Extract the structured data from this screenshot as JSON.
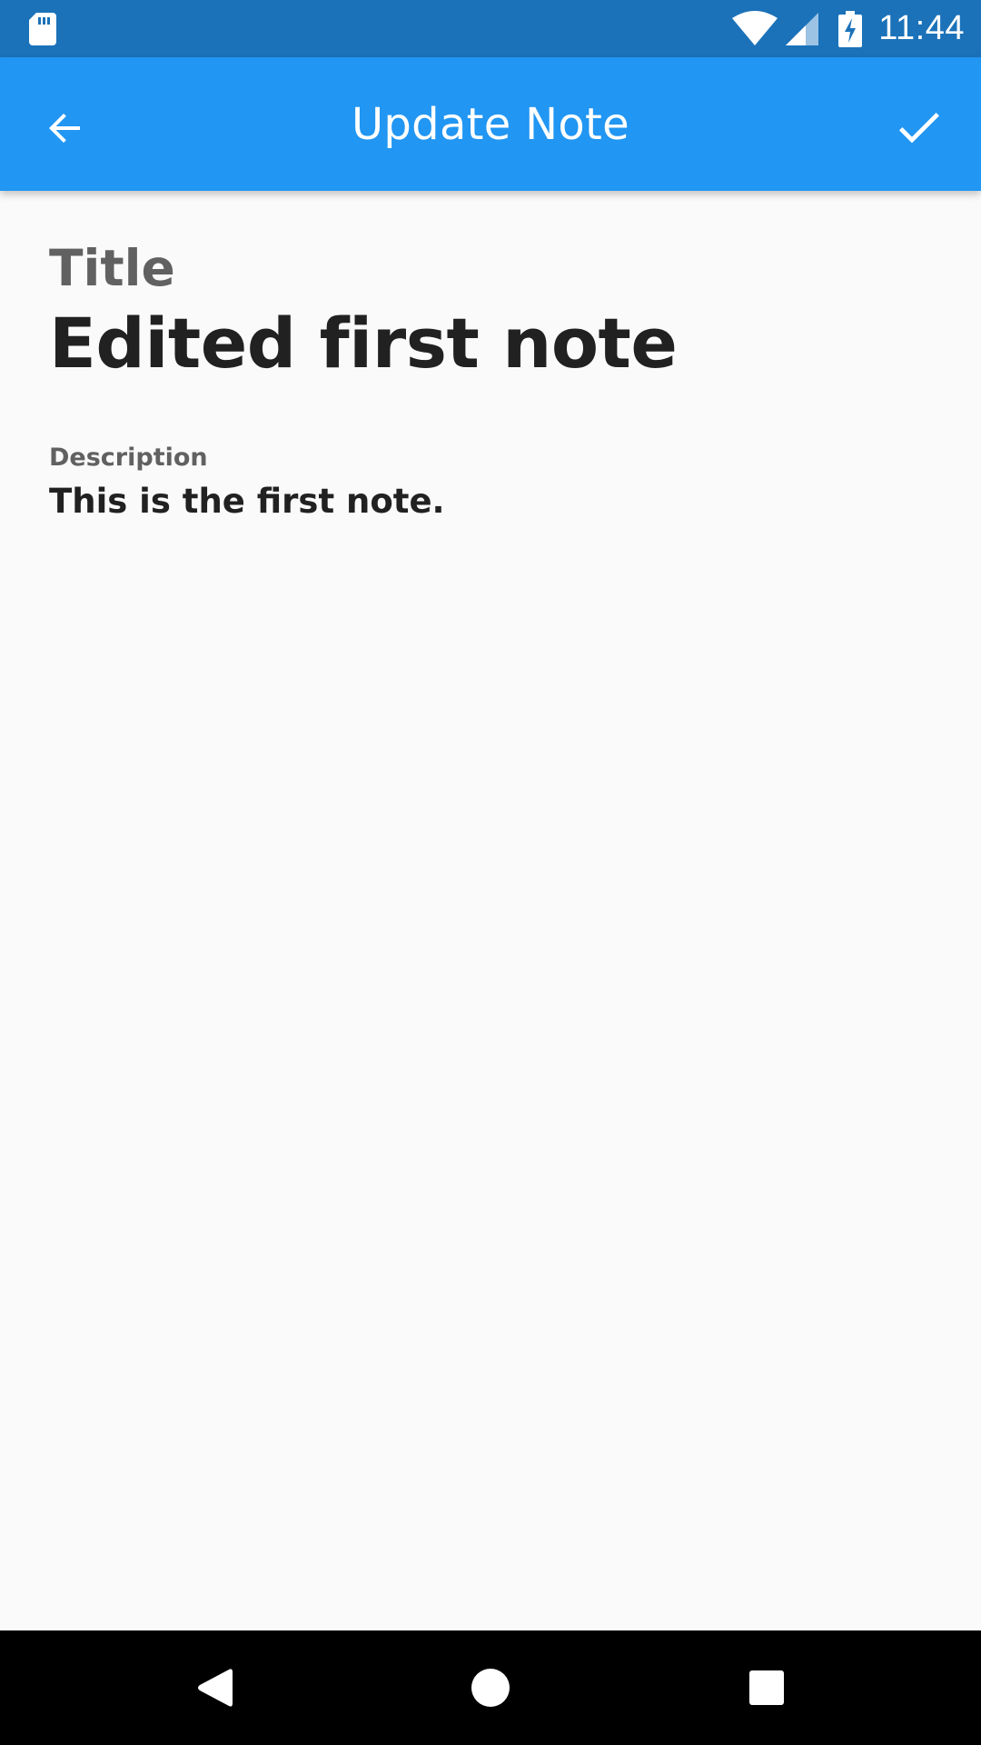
{
  "status_bar": {
    "time": "11:44",
    "icons": [
      "sd-card-icon",
      "wifi-icon",
      "signal-icon",
      "battery-charging-icon"
    ]
  },
  "app_bar": {
    "title": "Update Note",
    "back_icon": "arrow-back-icon",
    "action_icon": "check-icon",
    "color": "#2196f3"
  },
  "form": {
    "title_label": "Title",
    "title_value": "Edited first note",
    "description_label": "Description",
    "description_value": "This is the first note."
  },
  "nav_bar": {
    "icons": [
      "back-triangle-icon",
      "home-circle-icon",
      "recents-square-icon"
    ]
  }
}
